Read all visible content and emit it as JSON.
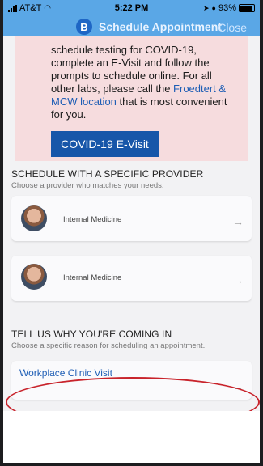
{
  "status_bar": {
    "carrier": "AT&T",
    "time": "5:22 PM",
    "battery": "93%"
  },
  "nav": {
    "logo_letter": "B",
    "title": "Schedule Appointment",
    "close_label": "Close"
  },
  "notice": {
    "line1": "schedule testing for COVID-19, complete an E-Visit and follow the prompts to schedule online. For all other labs, please call the ",
    "link_text": "Froedtert & MCW location",
    "line2": " that is most convenient for you.",
    "button_label": "COVID-19 E-Visit"
  },
  "provider_section": {
    "title": "SCHEDULE WITH A SPECIFIC PROVIDER",
    "subtitle": "Choose a provider who matches your needs.",
    "providers": [
      {
        "specialty": "Internal Medicine"
      },
      {
        "specialty": "Internal Medicine"
      }
    ]
  },
  "reason_section": {
    "title": "TELL US WHY YOU'RE COMING IN",
    "subtitle": "Choose a specific reason for scheduling an appointment.",
    "reasons": [
      {
        "label": "Workplace Clinic Visit"
      }
    ]
  },
  "icons": {
    "chevron": "→"
  },
  "colors": {
    "header": "#5aa7e6",
    "brand_blue": "#1756a9",
    "notice_bg": "#f6dcde",
    "highlight_ring": "#c8232b"
  }
}
